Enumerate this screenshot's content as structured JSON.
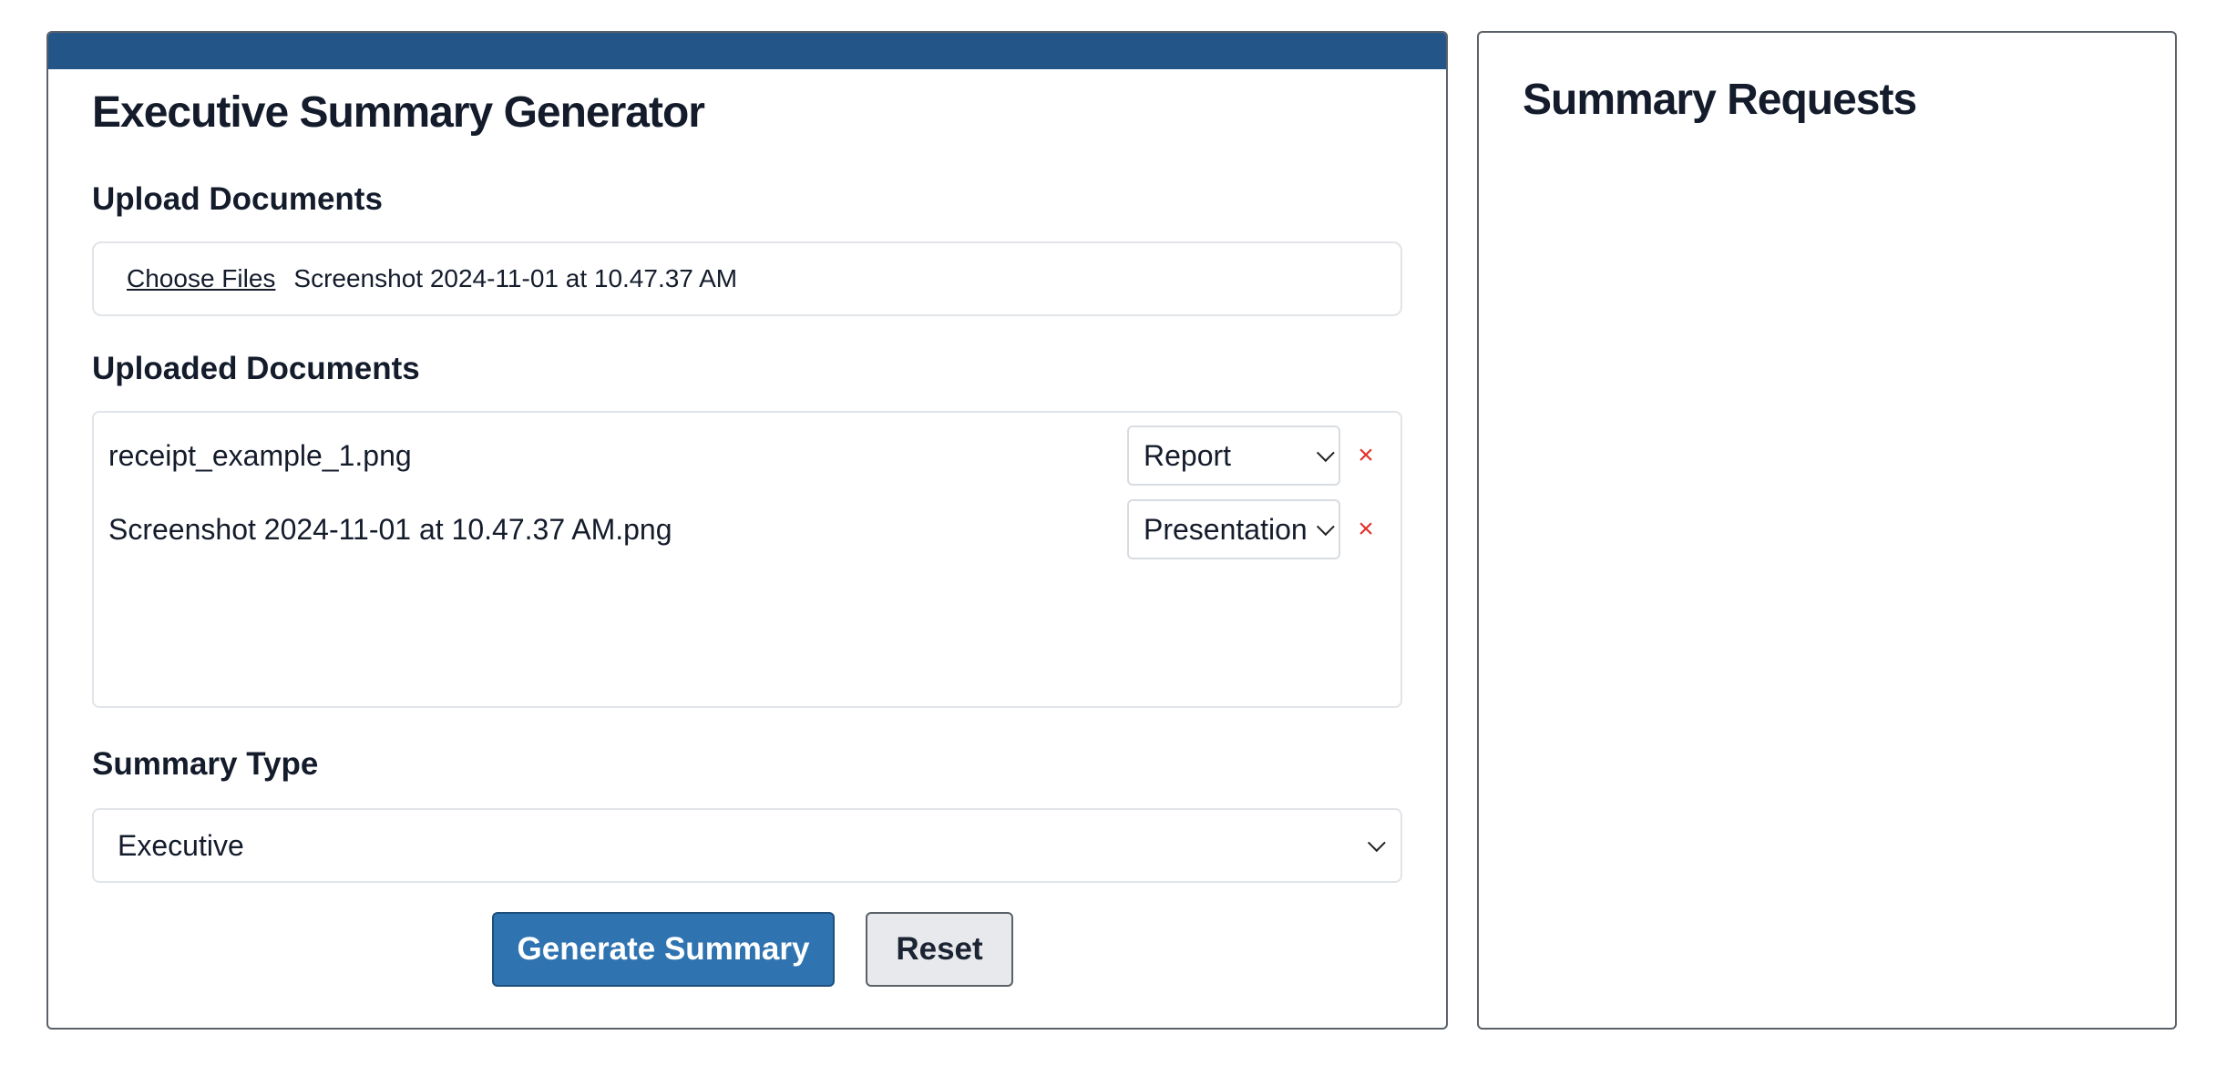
{
  "generator": {
    "title": "Executive Summary Generator",
    "upload": {
      "label": "Upload Documents",
      "choose_files_label": "Choose Files",
      "chosen_file_text": "Screenshot 2024-11-01 at 10.47.37 AM"
    },
    "uploaded": {
      "label": "Uploaded Documents",
      "documents": [
        {
          "name": "receipt_example_1.png",
          "type": "Report",
          "remove_label": "×"
        },
        {
          "name": "Screenshot 2024-11-01 at 10.47.37 AM.png",
          "type": "Presentation",
          "remove_label": "×"
        }
      ]
    },
    "summary_type": {
      "label": "Summary Type",
      "selected": "Executive"
    },
    "actions": {
      "generate_label": "Generate Summary",
      "reset_label": "Reset"
    }
  },
  "requests": {
    "title": "Summary Requests"
  },
  "colors": {
    "header_bar": "#235589",
    "primary_button": "#2f74b1",
    "remove_icon": "#e0312b"
  }
}
